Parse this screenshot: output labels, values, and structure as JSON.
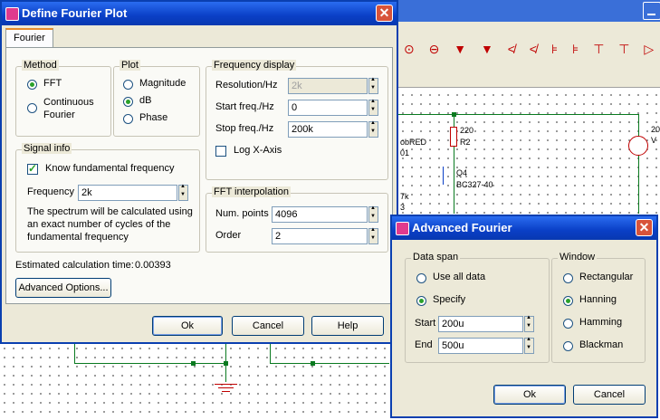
{
  "fourier_dialog": {
    "title": "Define Fourier Plot",
    "tab": "Fourier",
    "method": {
      "label": "Method",
      "options": [
        "FFT",
        "Continuous\nFourier"
      ],
      "selected": "FFT"
    },
    "plot": {
      "label": "Plot",
      "options": [
        "Magnitude",
        "dB",
        "Phase"
      ],
      "selected": "dB"
    },
    "frequency_display": {
      "label": "Frequency display",
      "resolution_label": "Resolution/Hz",
      "resolution_value": "2k",
      "start_label": "Start freq./Hz",
      "start_value": "0",
      "stop_label": "Stop freq./Hz",
      "stop_value": "200k",
      "log_axis_label": "Log X-Axis",
      "log_axis_checked": false
    },
    "signal_info": {
      "label": "Signal info",
      "know_fundamental_label": "Know fundamental frequency",
      "know_fundamental_checked": true,
      "frequency_label": "Frequency",
      "frequency_value": "2k",
      "description": "The spectrum will be calculated using\nan exact number of cycles of the\nfundamental frequency"
    },
    "fft_interpolation": {
      "label": "FFT interpolation",
      "num_points_label": "Num. points",
      "num_points_value": "4096",
      "order_label": "Order",
      "order_value": "2"
    },
    "estimated_time_label": "Estimated calculation time:",
    "estimated_time_value": "0.00393",
    "advanced_button": "Advanced Options...",
    "ok_button": "Ok",
    "cancel_button": "Cancel",
    "help_button": "Help"
  },
  "advanced_dialog": {
    "title": "Advanced Fourier",
    "data_span": {
      "label": "Data span",
      "options": [
        "Use all data",
        "Specify"
      ],
      "selected": "Specify",
      "start_label": "Start",
      "start_value": "200u",
      "end_label": "End",
      "end_value": "500u"
    },
    "window": {
      "label": "Window",
      "options": [
        "Rectangular",
        "Hanning",
        "Hamming",
        "Blackman"
      ],
      "selected": "Hanning"
    },
    "ok_button": "Ok",
    "cancel_button": "Cancel"
  },
  "schematic": {
    "labels": [
      "220",
      "R2",
      "obRED",
      "01",
      "Q4",
      "BC327-40",
      "7k",
      "3",
      "20",
      "V"
    ]
  },
  "colors": {
    "titlebar": "#0a3fc6",
    "dialog_bg": "#ece9d8",
    "wire": "#0a7a20",
    "radio_dot": "#2aa12a"
  }
}
